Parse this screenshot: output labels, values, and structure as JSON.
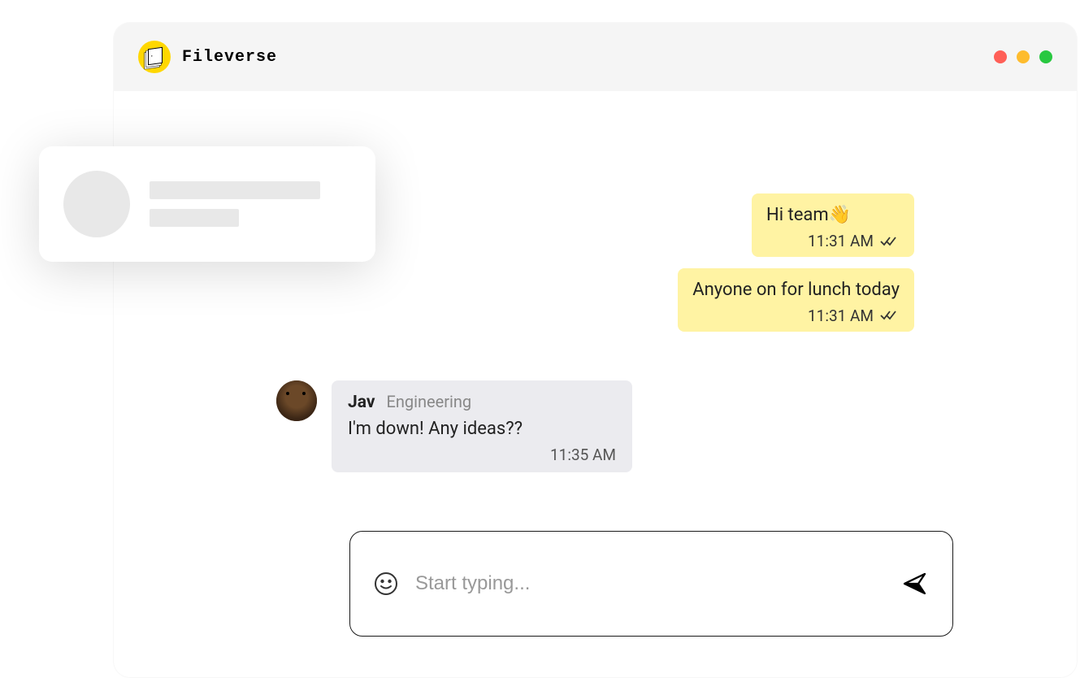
{
  "brand": {
    "name": "Fileverse"
  },
  "messages": {
    "sent": [
      {
        "text": "Hi team",
        "emoji": "👋",
        "time": "11:31 AM",
        "read": true
      },
      {
        "text": "Anyone on for lunch today",
        "time": "11:31 AM",
        "read": true
      }
    ],
    "received": [
      {
        "sender": "Jav",
        "department": "Engineering",
        "text": "I'm down! Any ideas??",
        "time": "11:35 AM"
      }
    ]
  },
  "composer": {
    "placeholder": "Start typing..."
  },
  "colors": {
    "accent": "#ffd700",
    "sent_bubble": "#fff3a3",
    "received_bubble": "#ebebef"
  }
}
